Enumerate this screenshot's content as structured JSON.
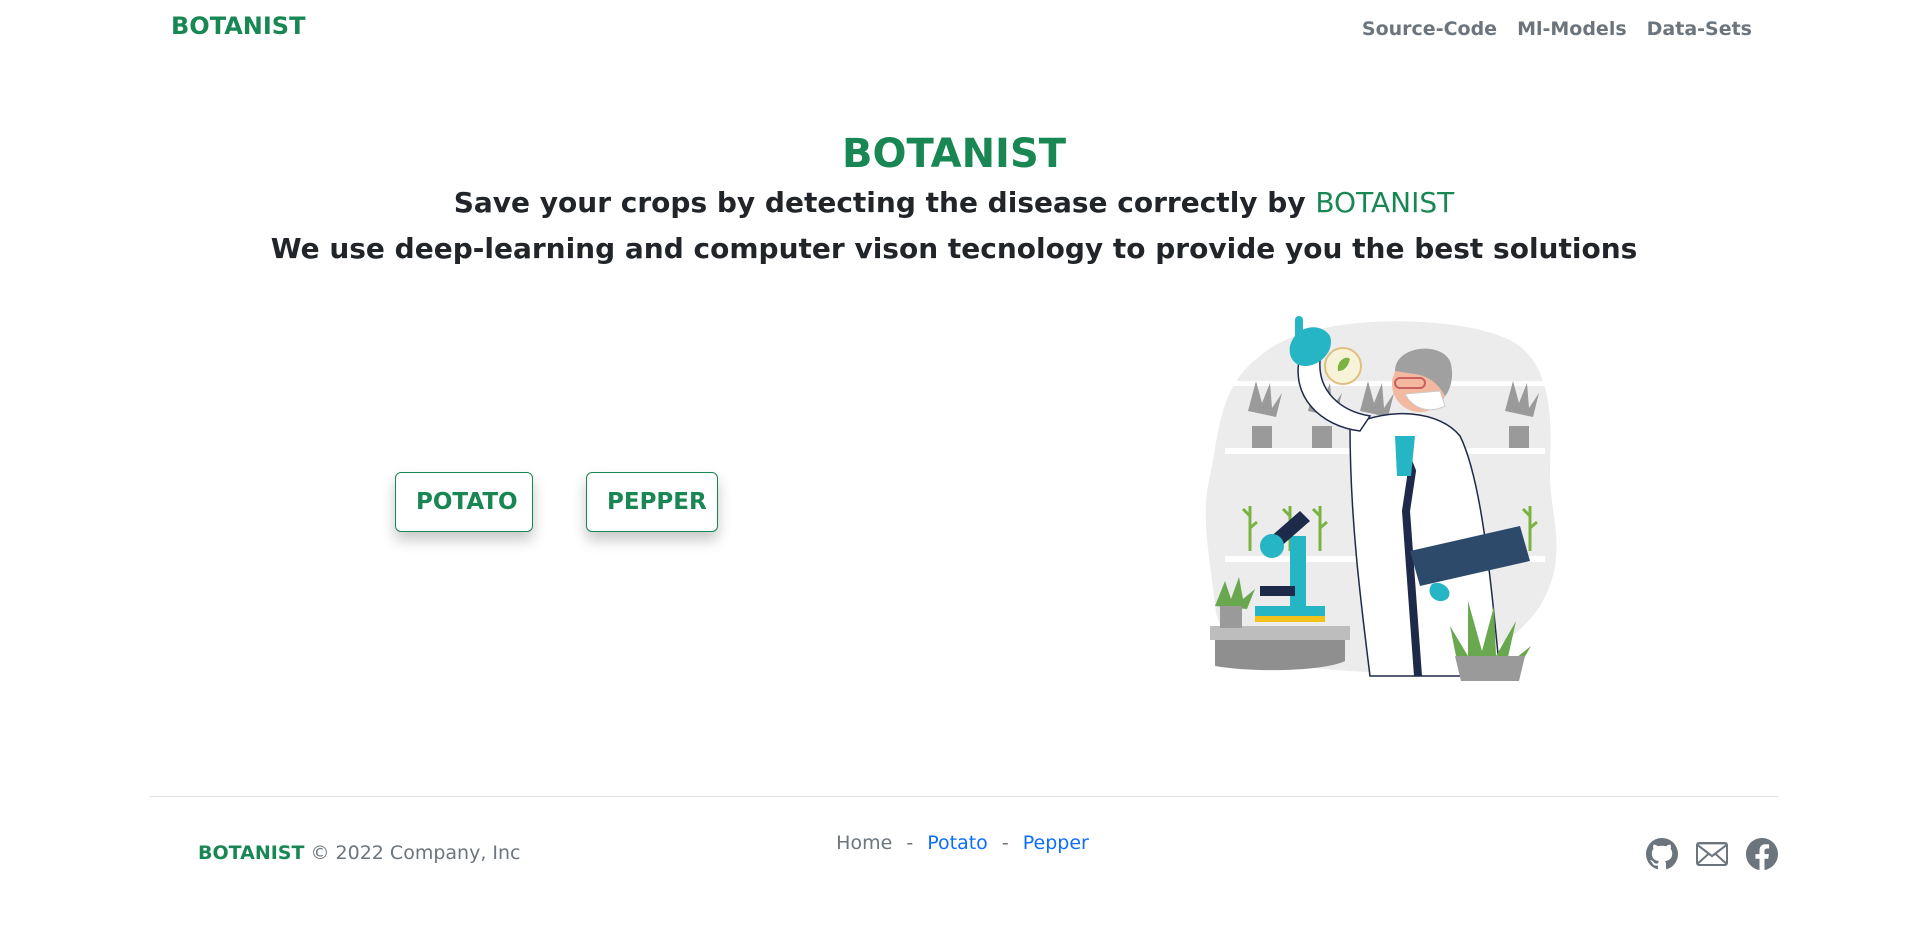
{
  "header": {
    "brand": "BOTANIST",
    "nav": [
      {
        "label": "Source-Code"
      },
      {
        "label": "Ml-Models"
      },
      {
        "label": "Data-Sets"
      }
    ]
  },
  "hero": {
    "title": "BOTANIST",
    "line1_prefix": "Save your crops by detecting the disease correctly by",
    "line1_accent": "BOTANIST",
    "line2": "We use deep-learning and computer vison tecnology to provide you the best solutions"
  },
  "buttons": {
    "potato": "POTATO",
    "pepper": "PEPPER"
  },
  "footer": {
    "brand": "BOTANIST",
    "copyright": "© 2022 Company, Inc",
    "links": {
      "home": "Home",
      "potato": "Potato",
      "pepper": "Pepper",
      "separator": "-"
    },
    "icons": [
      "github-icon",
      "mail-icon",
      "facebook-icon"
    ]
  },
  "colors": {
    "brand_green": "#198754",
    "link_blue": "#0d6efd",
    "muted_gray": "#6c757d",
    "accent_teal": "#26b5c4"
  }
}
